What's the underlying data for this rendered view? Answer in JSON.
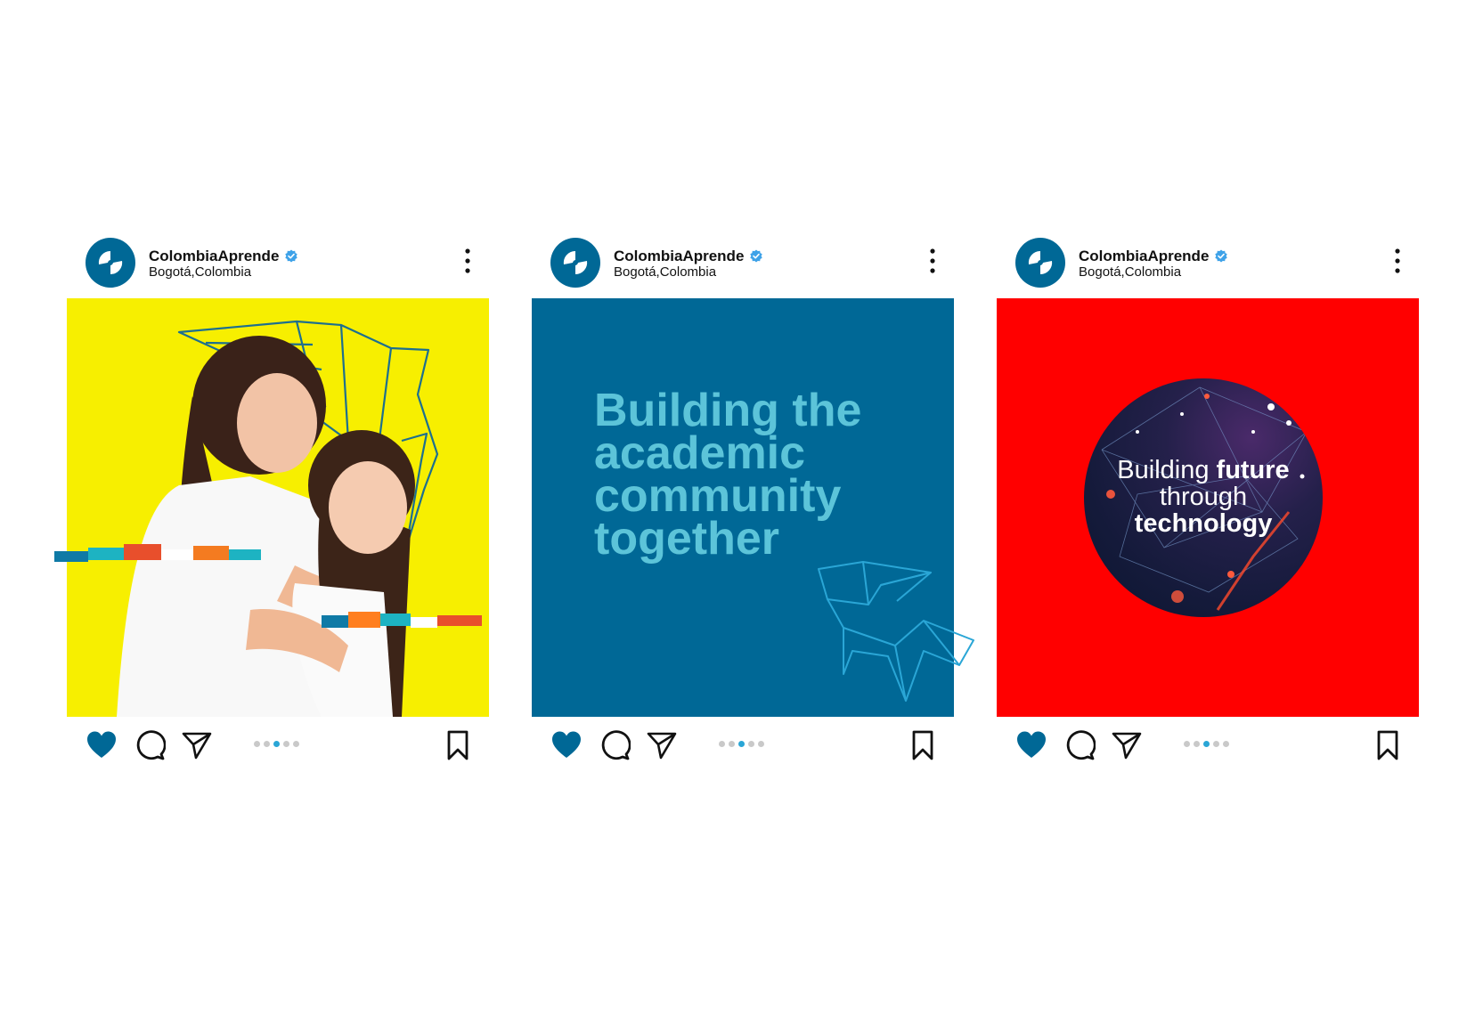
{
  "posts": [
    {
      "account": "ColombiaAprende",
      "location": "Bogotá,Colombia",
      "image": {
        "type": "photo",
        "background": "#f7ef00",
        "description_icon": "mother-daughter-hug-photo"
      }
    },
    {
      "account": "ColombiaAprende",
      "location": "Bogotá,Colombia",
      "image": {
        "type": "text",
        "background": "#006896",
        "headline": [
          "Building the",
          "academic",
          "community",
          "together"
        ]
      }
    },
    {
      "account": "ColombiaAprende",
      "location": "Bogotá,Colombia",
      "image": {
        "type": "tech",
        "background": "#ff0000",
        "line1_a": "Building ",
        "line1_b": "future",
        "line2": "through",
        "line3": "technology"
      }
    }
  ],
  "colors": {
    "brand_blue": "#006896",
    "accent_cyan": "#5cc4d9",
    "verified_blue": "#3ea2e8",
    "carousel_active": "#2aa6d6"
  },
  "carousel": {
    "count": 5,
    "active_index": 2
  }
}
